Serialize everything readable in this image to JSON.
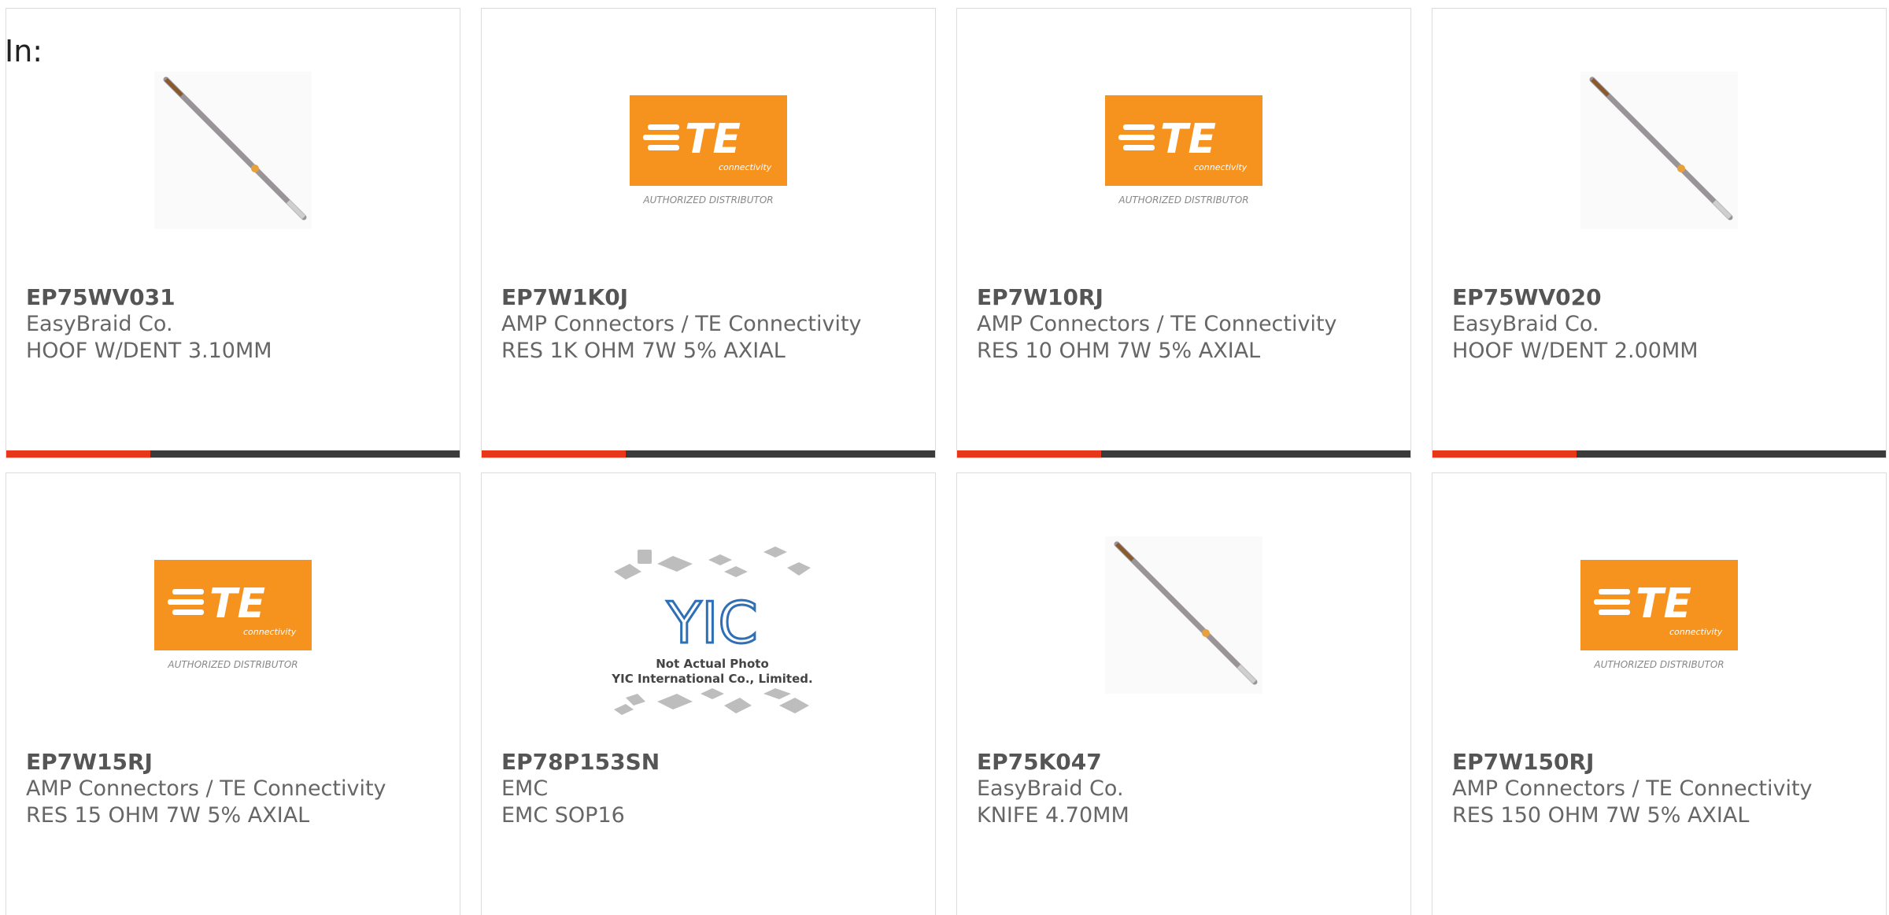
{
  "filter_label": "In:",
  "colors": {
    "bar_dark": "#3b3b3b",
    "bar_accent": "#e8381b",
    "te_orange": "#f6921e"
  },
  "products": [
    {
      "part_number": "EP75WV031",
      "manufacturer": "EasyBraid Co.",
      "description": "HOOF W/DENT 3.10MM",
      "image": "soldering-tip"
    },
    {
      "part_number": "EP7W1K0J",
      "manufacturer": "AMP Connectors / TE Connectivity",
      "description": "RES 1K OHM 7W 5% AXIAL",
      "image": "te-logo"
    },
    {
      "part_number": "EP7W10RJ",
      "manufacturer": "AMP Connectors / TE Connectivity",
      "description": "RES 10 OHM 7W 5% AXIAL",
      "image": "te-logo"
    },
    {
      "part_number": "EP75WV020",
      "manufacturer": "EasyBraid Co.",
      "description": "HOOF W/DENT 2.00MM",
      "image": "soldering-tip"
    },
    {
      "part_number": "EP7W15RJ",
      "manufacturer": "AMP Connectors / TE Connectivity",
      "description": "RES 15 OHM 7W 5% AXIAL",
      "image": "te-logo"
    },
    {
      "part_number": "EP78P153SN",
      "manufacturer": "EMC",
      "description": "EMC SOP16",
      "image": "yic-placeholder"
    },
    {
      "part_number": "EP75K047",
      "manufacturer": "EasyBraid Co.",
      "description": "KNIFE 4.70MM",
      "image": "soldering-tip"
    },
    {
      "part_number": "EP7W150RJ",
      "manufacturer": "AMP Connectors / TE Connectivity",
      "description": "RES 150 OHM 7W 5% AXIAL",
      "image": "te-logo"
    }
  ],
  "te_logo": {
    "letters": "TE",
    "subtext": "connectivity",
    "caption": "AUTHORIZED DISTRIBUTOR"
  },
  "yic_placeholder": {
    "logo_text": "YIC",
    "line1": "Not Actual Photo",
    "line2": "YIC International Co., Limited."
  }
}
